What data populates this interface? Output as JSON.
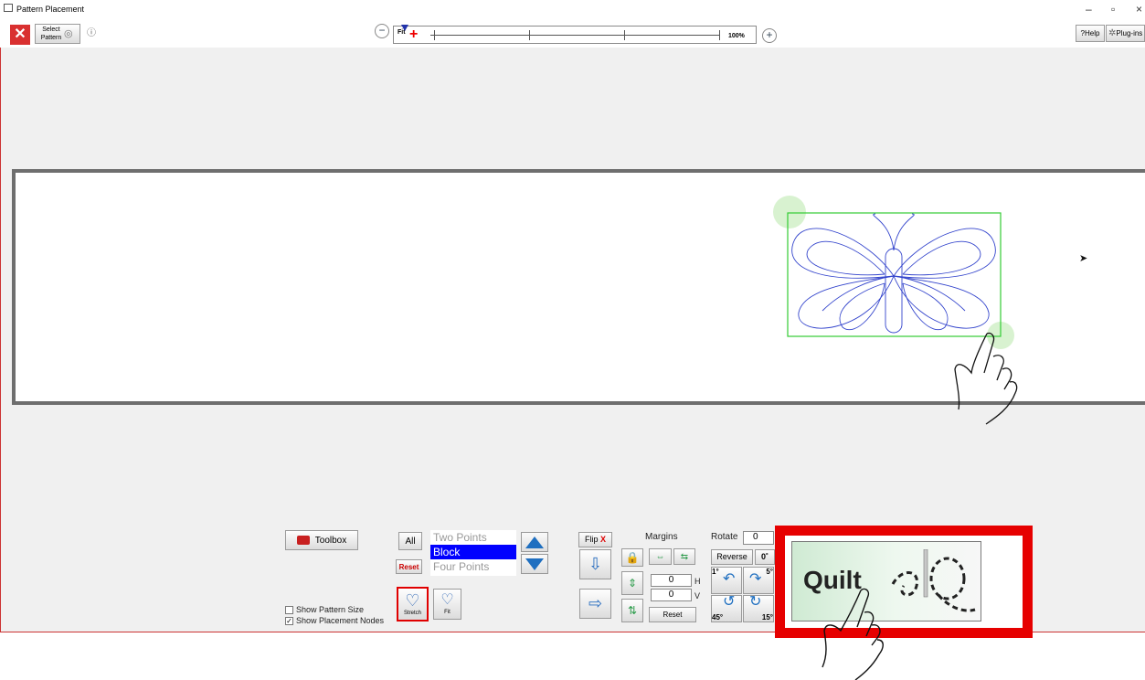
{
  "window": {
    "title": "Pattern Placement",
    "controls": [
      "–",
      "▫",
      "×"
    ]
  },
  "toolbar": {
    "close_label": "✕",
    "select_pattern_label": "Select Pattern",
    "info_label": "ⓘ",
    "zoom_out_label": "−",
    "fit_label": "Fit",
    "zoom_100_label": "100%",
    "zoom_in_label": "+",
    "help_label": "?Help",
    "plugins_label": "Plug-ins"
  },
  "panel": {
    "toolbox_label": "Toolbox",
    "all_label": "All",
    "reset_label": "Reset",
    "placement_modes": [
      {
        "label": "Two Points",
        "selected": false
      },
      {
        "label": "Block",
        "selected": true
      },
      {
        "label": "Four Points",
        "selected": false
      }
    ],
    "stretch_label": "Stretch",
    "fit_label": "Fit",
    "show_pattern_size": {
      "label": "Show Pattern Size",
      "checked": false
    },
    "show_placement_nodes": {
      "label": "Show Placement Nodes",
      "checked": true
    },
    "flip_label": "Flip",
    "flip_x_label": "X",
    "margins_label": "Margins",
    "margin_h_value": "0",
    "margin_h_unit": "H",
    "margin_v_value": "0",
    "margin_v_unit": "V",
    "margins_reset_label": "Reset",
    "rotate_label": "Rotate",
    "rotate_value": "0",
    "reverse_label": "Reverse",
    "zero_deg_label": "0˚",
    "rot_1_label": "1°",
    "rot_5_label": "5°",
    "rot_45_label": "45°",
    "rot_15_label": "15°"
  },
  "quilt": {
    "label": "Quilt"
  },
  "colors": {
    "highlight": "#e60000",
    "selection": "#0000ff",
    "pattern_box": "#33cc33",
    "pattern_stroke": "#3344cc"
  }
}
